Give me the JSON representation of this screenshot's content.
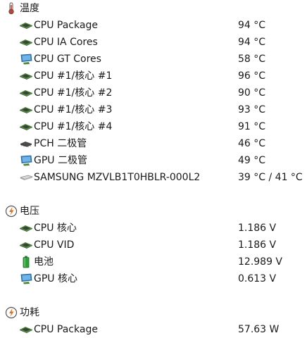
{
  "sensors": {
    "temperature": {
      "label": "温度",
      "icon": "thermometer-icon",
      "items": [
        {
          "label": "CPU Package",
          "value": "94 °C",
          "icon": "cpu-chip-icon"
        },
        {
          "label": "CPU IA Cores",
          "value": "94 °C",
          "icon": "cpu-chip-icon"
        },
        {
          "label": "CPU GT Cores",
          "value": "58 °C",
          "icon": "gpu-monitor-icon"
        },
        {
          "label": "CPU #1/核心 #1",
          "value": "96 °C",
          "icon": "cpu-chip-icon"
        },
        {
          "label": "CPU #1/核心 #2",
          "value": "90 °C",
          "icon": "cpu-chip-icon"
        },
        {
          "label": "CPU #1/核心 #3",
          "value": "93 °C",
          "icon": "cpu-chip-icon"
        },
        {
          "label": "CPU #1/核心 #4",
          "value": "91 °C",
          "icon": "cpu-chip-icon"
        },
        {
          "label": "PCH 二极管",
          "value": "46 °C",
          "icon": "pch-chip-icon"
        },
        {
          "label": "GPU 二极管",
          "value": "49 °C",
          "icon": "gpu-monitor-icon"
        },
        {
          "label": "SAMSUNG MZVLB1T0HBLR-000L2",
          "value": "39 °C / 41 °C",
          "icon": "drive-icon"
        }
      ]
    },
    "voltage": {
      "label": "电压",
      "icon": "voltage-icon",
      "items": [
        {
          "label": "CPU 核心",
          "value": "1.186 V",
          "icon": "cpu-chip-icon"
        },
        {
          "label": "CPU VID",
          "value": "1.186 V",
          "icon": "cpu-chip-icon"
        },
        {
          "label": "电池",
          "value": "12.989 V",
          "icon": "battery-icon"
        },
        {
          "label": "GPU 核心",
          "value": "0.613 V",
          "icon": "gpu-monitor-icon"
        }
      ]
    },
    "power": {
      "label": "功耗",
      "icon": "power-icon",
      "items": [
        {
          "label": "CPU Package",
          "value": "57.63 W",
          "icon": "cpu-chip-icon"
        }
      ]
    }
  },
  "colors": {
    "chip_green": "#4a8a3a",
    "chip_body": "#3f3f3f",
    "monitor_blue": "#3a86c8",
    "category_orange": "#e0701a",
    "battery_green": "#2f9e3a"
  }
}
